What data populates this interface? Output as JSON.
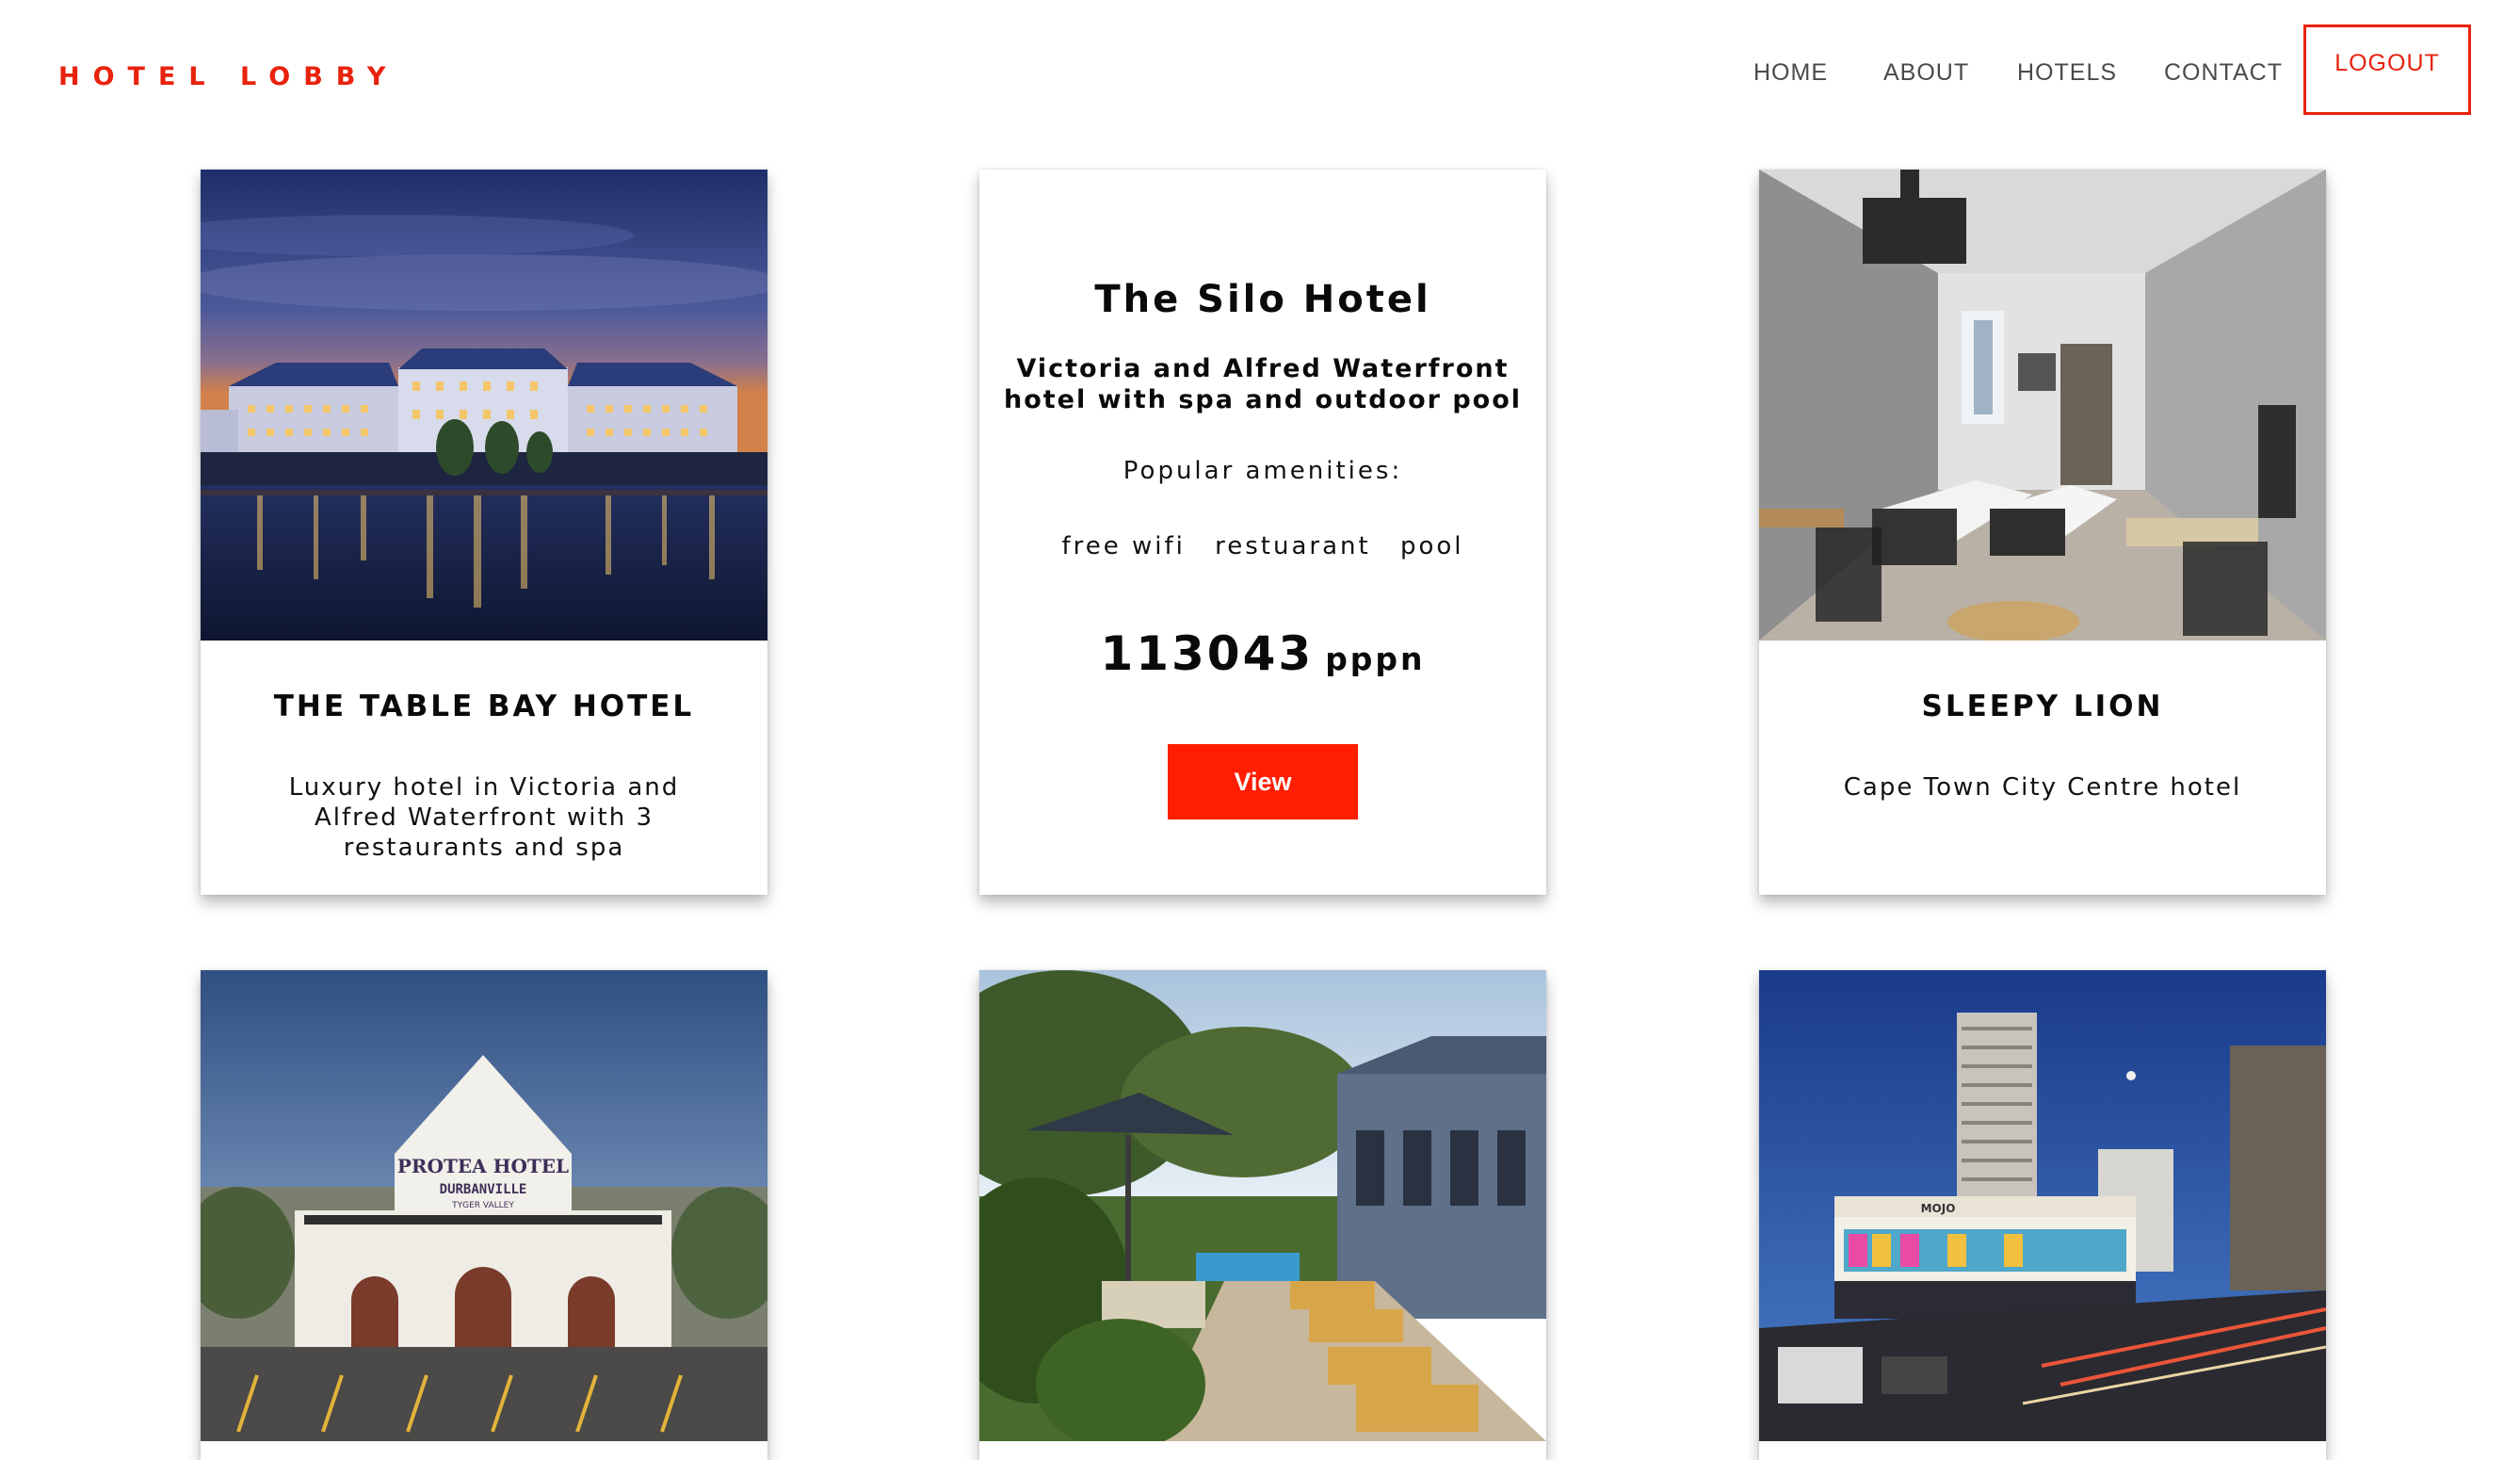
{
  "brand": "HOTEL LOBBY",
  "nav": {
    "home": "HOME",
    "about": "ABOUT",
    "hotels": "HOTELS",
    "contact": "CONTACT",
    "logout": "LOGOUT"
  },
  "cards": [
    {
      "title": "THE TABLE BAY HOTEL",
      "description": "Luxury hotel in Victoria and Alfred Waterfront with 3 restaurants and spa"
    },
    {
      "title": "The Silo Hotel",
      "subtitle": "Victoria and Alfred Waterfront hotel with spa and outdoor pool",
      "amenities_heading": "Popular amenities:",
      "amenities": [
        "free wifi",
        "restuarant",
        "pool"
      ],
      "price": "113043",
      "price_unit": "pppn",
      "button": "View"
    },
    {
      "title": "SLEEPY LION",
      "description": "Cape Town City Centre hotel"
    }
  ],
  "colors": {
    "accent": "#e8220c",
    "button": "#ff1e00"
  }
}
